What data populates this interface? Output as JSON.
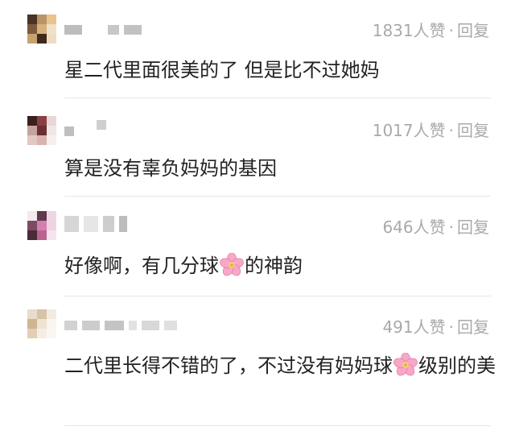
{
  "comments": [
    {
      "likes": "1831人赞",
      "sep": "·",
      "reply": "回复",
      "text": "星二代里面很美的了 但是比不过她妈",
      "avatar_colors": [
        "#4a3322",
        "#b99466",
        "#e8c38b",
        "#7a5a3b",
        "#d9b07c",
        "#f0e1c9",
        "#c8a171",
        "#3c2a1c",
        "#efdcc2"
      ]
    },
    {
      "likes": "1017人赞",
      "sep": "·",
      "reply": "回复",
      "text": "算是没有辜负妈妈的基因",
      "avatar_colors": [
        "#3a201c",
        "#8a3f45",
        "#e7d8d7",
        "#c7a39e",
        "#6b2f31",
        "#f1e6e5",
        "#e3c7c3",
        "#d9b3ad",
        "#f6efee"
      ]
    },
    {
      "likes": "646人赞",
      "sep": "·",
      "reply": "回复",
      "text_before": "好像啊，有几分球",
      "text_after": "的神韵",
      "avatar_colors": [
        "#f3e9ee",
        "#5e3a4a",
        "#ecd7e3",
        "#7d4a63",
        "#d37fb1",
        "#f0d2e3",
        "#4a2b38",
        "#b9648f",
        "#f4e4ed"
      ]
    },
    {
      "likes": "491人赞",
      "sep": "·",
      "reply": "回复",
      "text_before": "二代里长得不错的了，不过没有妈妈球",
      "text_after": "级别的美",
      "avatar_colors": [
        "#e9dccb",
        "#d7c3a8",
        "#f3ebe0",
        "#cdb592",
        "#efe3d2",
        "#faf5ee",
        "#e2d0b6",
        "#f6eee3",
        "#fbf7f1"
      ]
    }
  ],
  "flower_icon": "cherry-blossom-icon"
}
